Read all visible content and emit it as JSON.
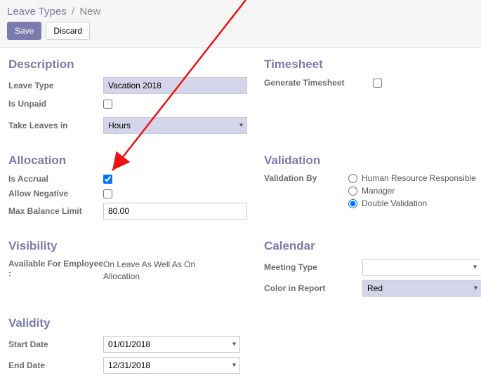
{
  "breadcrumb": {
    "root": "Leave Types",
    "current": "New"
  },
  "actions": {
    "save": "Save",
    "discard": "Discard"
  },
  "description": {
    "title": "Description",
    "leave_type_label": "Leave Type",
    "leave_type_value": "Vacation 2018",
    "is_unpaid_label": "Is Unpaid",
    "is_unpaid_checked": false,
    "take_leaves_label": "Take Leaves in",
    "take_leaves_value": "Hours"
  },
  "timesheet": {
    "title": "Timesheet",
    "generate_label": "Generate Timesheet",
    "generate_checked": false
  },
  "allocation": {
    "title": "Allocation",
    "is_accrual_label": "Is Accrual",
    "is_accrual_checked": true,
    "allow_negative_label": "Allow Negative",
    "allow_negative_checked": false,
    "max_balance_label": "Max Balance Limit",
    "max_balance_value": "80.00"
  },
  "validation": {
    "title": "Validation",
    "validation_by_label": "Validation By",
    "options": [
      "Human Resource Responsible",
      "Manager",
      "Double Validation"
    ],
    "selected": "Double Validation"
  },
  "visibility": {
    "title": "Visibility",
    "available_for_label": "Available For Employee :",
    "available_for_value": "On Leave As Well As On Allocation"
  },
  "calendar": {
    "title": "Calendar",
    "meeting_type_label": "Meeting Type",
    "meeting_type_value": "",
    "color_label": "Color in Report",
    "color_value": "Red"
  },
  "validity": {
    "title": "Validity",
    "start_date_label": "Start Date",
    "start_date_value": "01/01/2018",
    "end_date_label": "End Date",
    "end_date_value": "12/31/2018"
  },
  "annotation": {
    "arrow_color": "#e11"
  }
}
